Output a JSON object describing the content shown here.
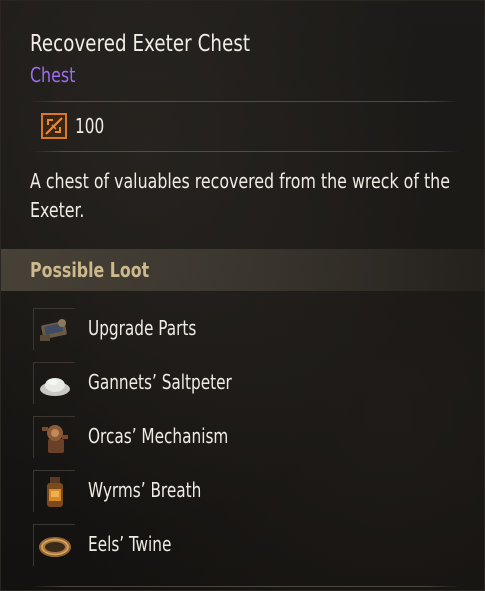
{
  "item": {
    "name": "Recovered Exeter Chest",
    "category": "Chest",
    "value": "100",
    "value_icon": "slashed-box-icon",
    "description": "A chest of valuables recovered from the wreck of the Exeter."
  },
  "loot": {
    "title": "Possible Loot",
    "items": [
      {
        "label": "Upgrade Parts",
        "icon": "upgrade-parts-icon"
      },
      {
        "label": "Gannets’ Saltpeter",
        "icon": "saltpeter-icon"
      },
      {
        "label": "Orcas’ Mechanism",
        "icon": "mechanism-icon"
      },
      {
        "label": "Wyrms’ Breath",
        "icon": "wyrms-breath-icon"
      },
      {
        "label": "Eels’ Twine",
        "icon": "twine-icon"
      }
    ]
  },
  "colors": {
    "category": "#9c6df0",
    "loot_title": "#cdb98d",
    "value_icon": "#d9772b"
  }
}
